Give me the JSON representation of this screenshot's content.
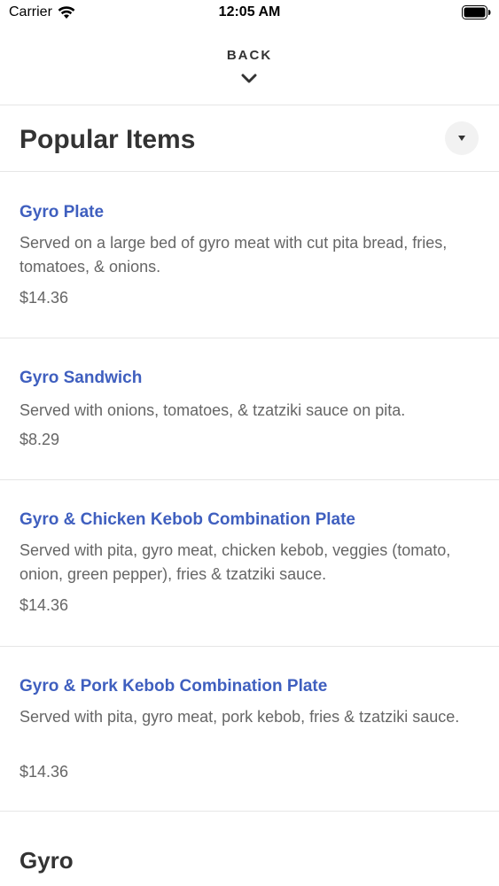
{
  "status_bar": {
    "carrier": "Carrier",
    "time": "12:05 AM",
    "icons": [
      "wifi-icon",
      "battery-icon"
    ]
  },
  "nav": {
    "back_label": "BACK",
    "back_icon": "chevron-down-icon"
  },
  "section": {
    "title": "Popular Items",
    "toggle_icon": "caret-down-icon"
  },
  "items": [
    {
      "name": "Gyro Plate",
      "description": "Served on a large bed of gyro meat with cut pita bread, fries, tomatoes, & onions.",
      "price": "$14.36"
    },
    {
      "name": "Gyro Sandwich",
      "description": "Served with onions, tomatoes, & tzatziki sauce on pita.",
      "price": "$8.29"
    },
    {
      "name": "Gyro & Chicken Kebob Combination Plate",
      "description": "Served with pita, gyro meat, chicken kebob, veggies (tomato, onion, green pepper), fries & tzatziki sauce.",
      "price": "$14.36"
    },
    {
      "name": "Gyro & Pork Kebob Combination Plate",
      "description": "Served with pita, gyro meat, pork kebob, fries & tzatziki sauce.",
      "price": "$14.36"
    }
  ],
  "next_section": {
    "title": "Gyro"
  },
  "colors": {
    "item_name": "#3f5fbf",
    "text": "#333333",
    "muted": "#666666",
    "divider": "#e6e6e6"
  }
}
